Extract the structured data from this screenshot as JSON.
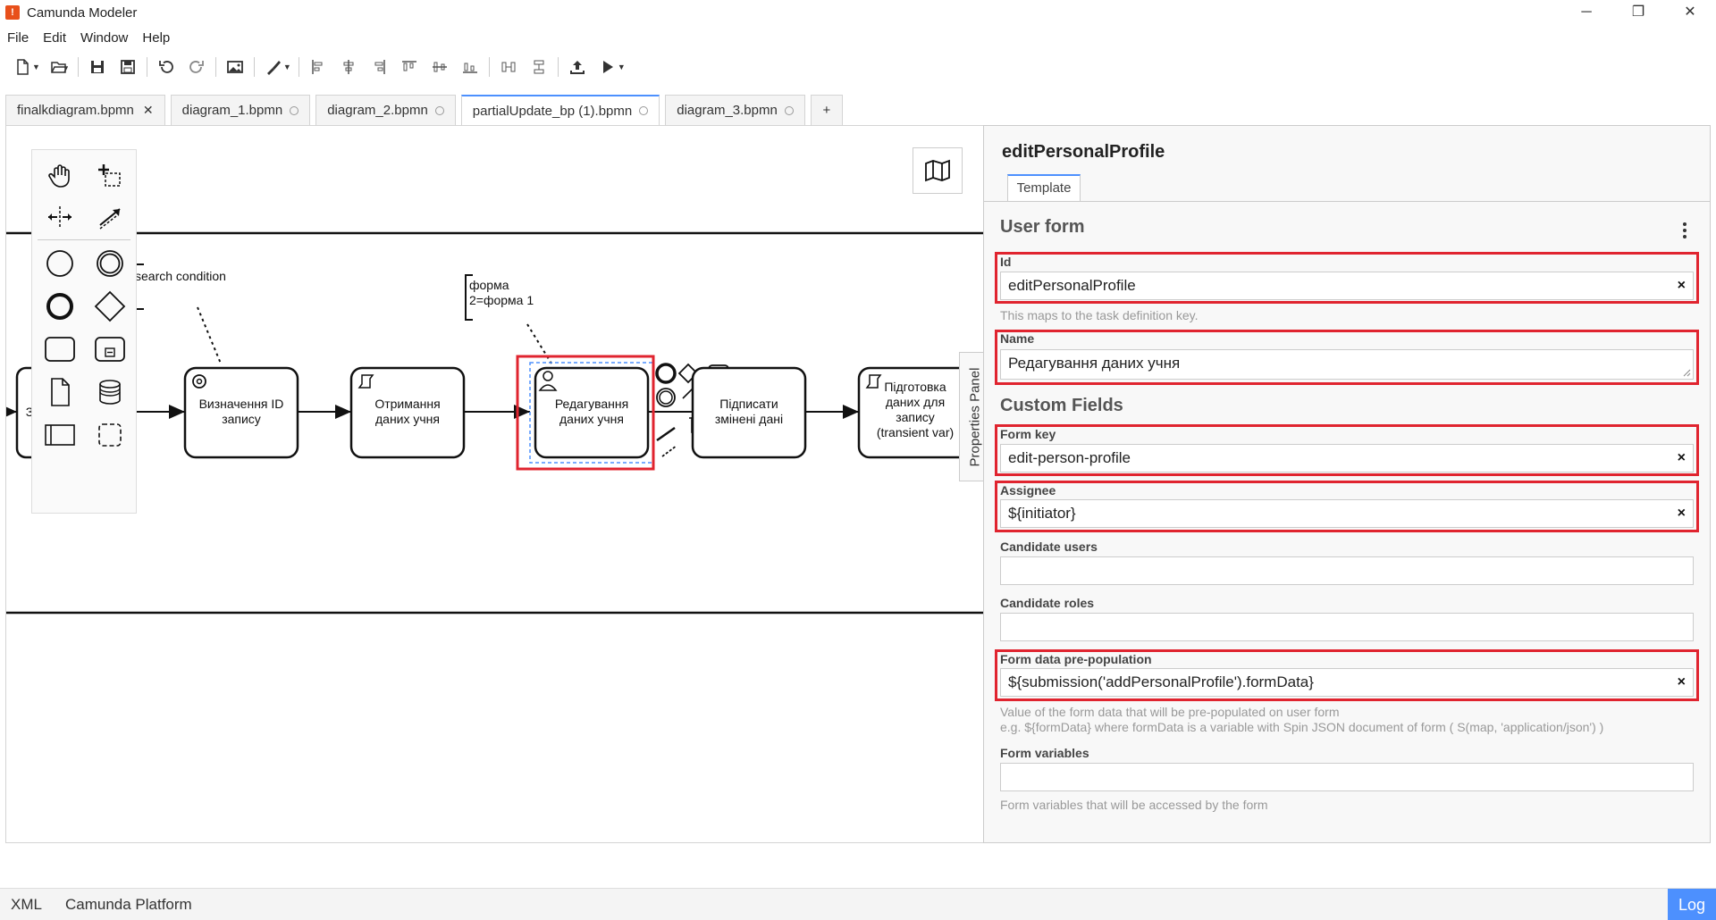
{
  "window": {
    "title": "Camunda Modeler",
    "controls": [
      "─",
      "❐",
      "✕"
    ]
  },
  "menu": [
    "File",
    "Edit",
    "Window",
    "Help"
  ],
  "tabs": [
    {
      "label": "finalkdiagram.bpmn",
      "close": "✕",
      "active": false
    },
    {
      "label": "diagram_1.bpmn",
      "active": false
    },
    {
      "label": "diagram_2.bpmn",
      "active": false
    },
    {
      "label": "partialUpdate_bp (1).bpmn",
      "active": true
    },
    {
      "label": "diagram_3.bpmn",
      "active": false
    }
  ],
  "tab_add": "+",
  "diagram": {
    "annotation_search": "search condition",
    "annotation_form_1": "форма",
    "annotation_form_2": "2=форма 1",
    "task_partial": "З",
    "task_1": [
      "Визначення ID",
      "запису"
    ],
    "task_2": [
      "Отримання",
      "даних учня"
    ],
    "task_3": [
      "Редагування",
      "даних учня"
    ],
    "task_4": [
      "Підписати",
      "змінені дані"
    ],
    "task_5": [
      "Підготовка",
      "даних для",
      "запису",
      "(transient var)"
    ]
  },
  "props_toggle": "Properties Panel",
  "panel": {
    "title": "editPersonalProfile",
    "tab": "Template",
    "section_user_form": "User form",
    "id_label": "Id",
    "id_value": "editPersonalProfile",
    "id_hint": "This maps to the task definition key.",
    "name_label": "Name",
    "name_value": "Редагування даних учня",
    "section_custom": "Custom Fields",
    "form_key_label": "Form key",
    "form_key_value": "edit-person-profile",
    "assignee_label": "Assignee",
    "assignee_value": "${initiator}",
    "cand_users_label": "Candidate users",
    "cand_roles_label": "Candidate roles",
    "prepop_label": "Form data pre-population",
    "prepop_value": "${submission('addPersonalProfile').formData}",
    "prepop_hint_1": "Value of the form data that will be pre-populated on user form",
    "prepop_hint_2": "e.g. ${formData} where formData is a variable with Spin JSON document of form ( S(map, 'application/json') )",
    "form_vars_label": "Form variables",
    "form_vars_hint": "Form variables that will be accessed by the form",
    "clear": "×"
  },
  "status": {
    "xml": "XML",
    "platform": "Camunda Platform",
    "log": "Log"
  },
  "colors": {
    "accent": "#4d90fe",
    "highlight": "#e0242f",
    "logo": "#e8501b"
  }
}
